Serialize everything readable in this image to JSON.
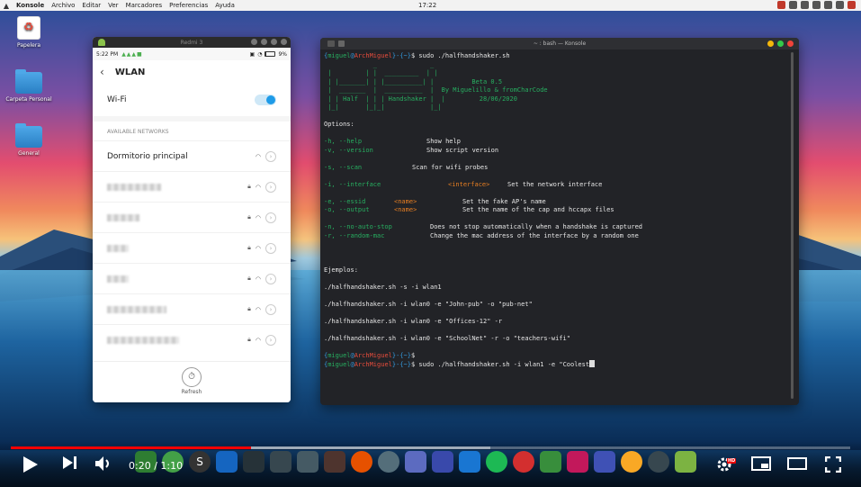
{
  "topbar": {
    "menu": [
      "Konsole",
      "Archivo",
      "Editar",
      "Ver",
      "Marcadores",
      "Preferencias",
      "Ayuda"
    ],
    "clock": "17:22"
  },
  "desktop": {
    "icons": [
      {
        "label": "Papelera"
      },
      {
        "label": "Carpeta Personal"
      },
      {
        "label": "General"
      }
    ]
  },
  "phone": {
    "window_title": "Redmi 3",
    "status_time": "5:22 PM",
    "battery": "9%",
    "header": "WLAN",
    "wifi_label": "Wi-Fi",
    "section_label": "AVAILABLE NETWORKS",
    "first_network": "Dormitorio principal",
    "refresh_label": "Refresh"
  },
  "terminal": {
    "title": "~ : bash — Konsole",
    "prompt_user": "miguel",
    "prompt_host": "ArchMiguel",
    "prompt_dir": "~",
    "command1": "sudo ./halfhandshaker.sh",
    "banner": [
      "             _              _ ",
      " |         | |  _________  | |",
      " | |_______| | |__________| |          Beta 0.5",
      " |  _______  |  __________  |  By Miguelillo & fromCharCode",
      " | | Half  | | | Handshaker |  |         28/06/2020",
      " |_|       |_|_|            |_|"
    ],
    "options_title": "Options:",
    "opt_help_flag": "-h, --help",
    "opt_help_desc": "Show help",
    "opt_version_flag": "-v, --version",
    "opt_version_desc": "Show script version",
    "opt_scan_flag": "-s, --scan",
    "opt_scan_desc": "Scan for wifi probes",
    "opt_iface_flag": "-i, --interface",
    "opt_iface_arg": "<interface>",
    "opt_iface_desc": "Set the network interface",
    "opt_essid_flag": "-e, --essid",
    "opt_essid_arg": "<name>",
    "opt_essid_desc": "Set the fake AP's name",
    "opt_output_flag": "-o, --output",
    "opt_output_arg": "<name>",
    "opt_output_desc": "Set the name of the cap and hccapx files",
    "opt_noauto_flag": "-n, --no-auto-stop",
    "opt_noauto_desc": "Does not stop automatically when a handshake is captured",
    "opt_mac_flag": "-r, --random-mac",
    "opt_mac_desc": "Change the mac address of the interface by a random one",
    "examples_title": "Ejemplos:",
    "examples": [
      "./halfhandshaker.sh -s -i wlan1",
      "./halfhandshaker.sh -i wlan0 -e \"John-pub\" -o \"pub-net\"",
      "./halfhandshaker.sh -i wlan0 -e \"Offices-12\" -r",
      "./halfhandshaker.sh -i wlan0 -e \"SchoolNet\" -r -o \"teachers-wifi\""
    ],
    "command3": "sudo ./halfhandshaker.sh -i wlan1 -e \"Coolest"
  },
  "video": {
    "time": "0:20 / 1:10",
    "progress_fraction": 0.286,
    "buffer_fraction": 0.285,
    "hd_badge": "HD"
  }
}
